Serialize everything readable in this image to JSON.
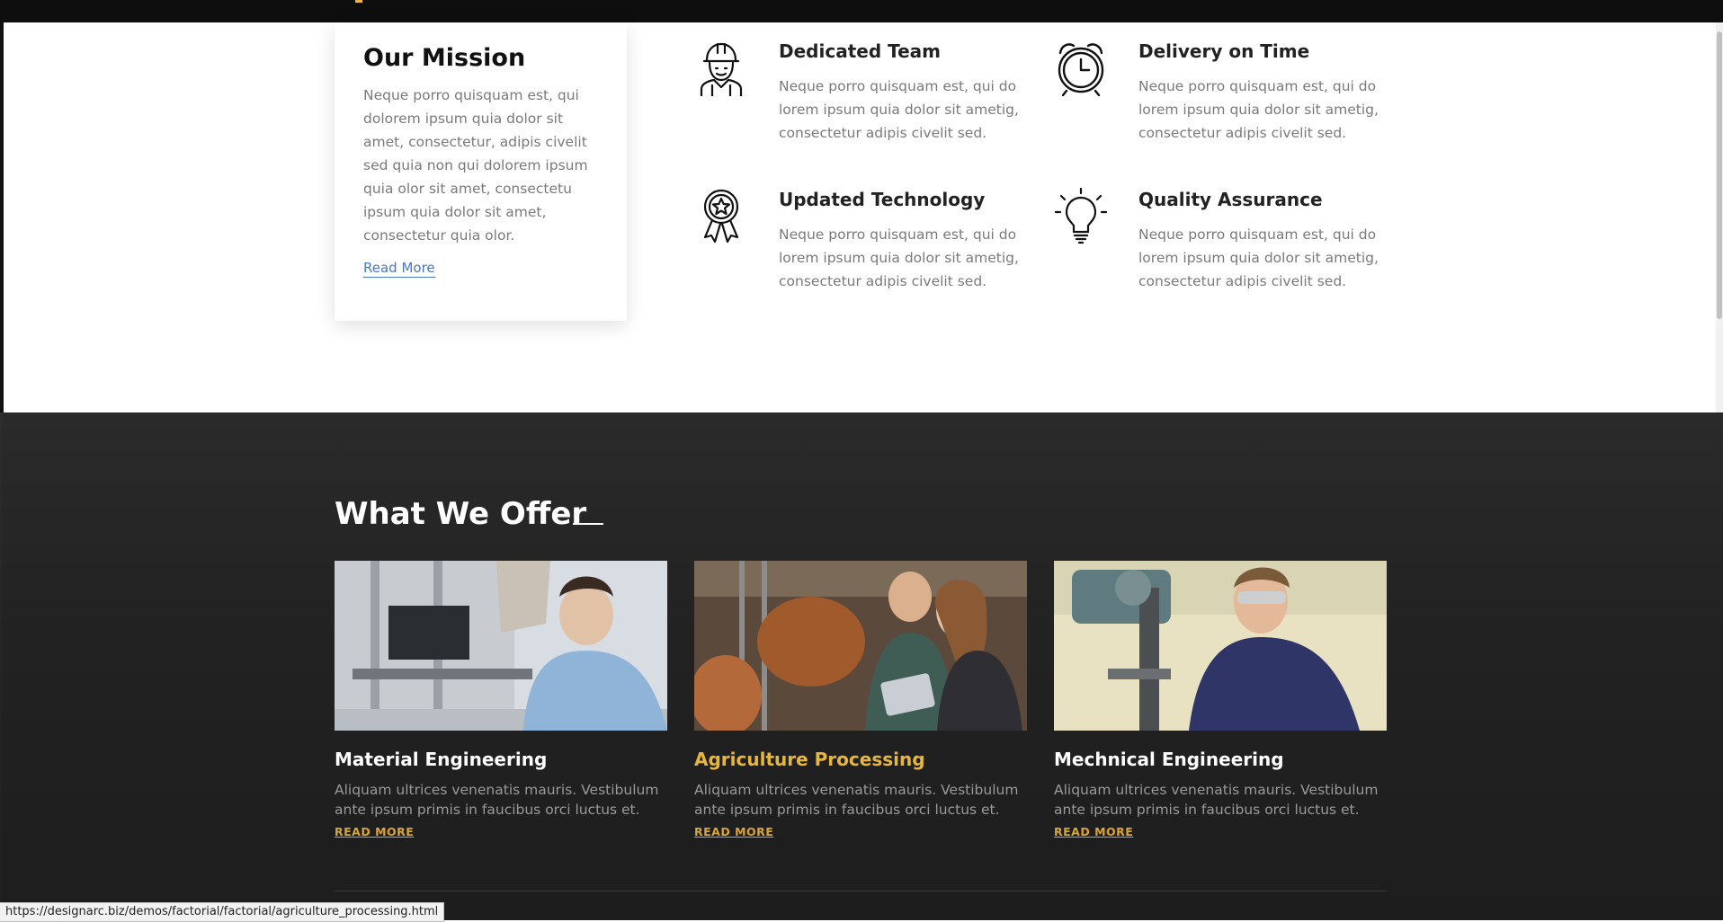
{
  "mission": {
    "title": "Our Mission",
    "body": "Neque porro quisquam est, qui dolorem ipsum quia dolor sit amet, consectetur, adipis civelit sed quia non qui dolorem ipsum quia olor sit amet, consectetu ipsum quia dolor sit amet, consectetur quia olor.",
    "link": "Read More"
  },
  "features": [
    {
      "title": "Dedicated Team",
      "icon": "worker-icon",
      "body": "Neque porro quisquam est, qui do lorem ipsum quia dolor sit ametig, consectetur adipis civelit sed."
    },
    {
      "title": "Delivery on Time",
      "icon": "alarm-clock-icon",
      "body": "Neque porro quisquam est, qui do lorem ipsum quia dolor sit ametig, consectetur adipis civelit sed."
    },
    {
      "title": "Updated Technology",
      "icon": "award-badge-icon",
      "body": "Neque porro quisquam est, qui do lorem ipsum quia dolor sit ametig, consectetur adipis civelit sed."
    },
    {
      "title": "Quality Assurance",
      "icon": "lightbulb-icon",
      "body": "Neque porro quisquam est, qui do lorem ipsum quia dolor sit ametig, consectetur adipis civelit sed."
    }
  ],
  "offer": {
    "title": "What We Offer",
    "items": [
      {
        "title": "Material Engineering",
        "body": "Aliquam ultrices venenatis mauris. Vestibulum ante ipsum primis in faucibus orci luctus et.",
        "link": "READ MORE"
      },
      {
        "title": "Agriculture Processing",
        "body": "Aliquam ultrices venenatis mauris. Vestibulum ante ipsum primis in faucibus orci luctus et.",
        "link": "READ MORE"
      },
      {
        "title": "Mechnical Engineering",
        "body": "Aliquam ultrices venenatis mauris. Vestibulum ante ipsum primis in faucibus orci luctus et.",
        "link": "READ MORE"
      }
    ]
  },
  "status_bar": {
    "url": "https://designarc.biz/demos/factorial/factorial/agriculture_processing.html"
  },
  "colors": {
    "accent": "#e8b73a",
    "dark_bg": "#232323",
    "link_blue": "#4a78c8"
  }
}
